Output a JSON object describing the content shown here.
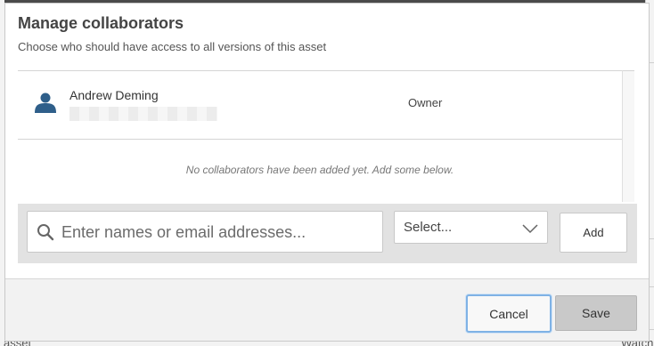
{
  "dialog": {
    "title": "Manage collaborators",
    "subtitle": "Choose who should have access to all versions of this asset"
  },
  "collaborators": [
    {
      "name": "Andrew Deming",
      "role": "Owner",
      "icon": "person-icon"
    }
  ],
  "empty_message": "No collaborators have been added yet. Add some below.",
  "add_bar": {
    "search_placeholder": "Enter names or email addresses...",
    "search_value": "",
    "role_select_value": "Select...",
    "add_label": "Add"
  },
  "footer": {
    "cancel_label": "Cancel",
    "save_label": "Save"
  },
  "background": {
    "fragment_bottom_left": "asset",
    "fragment_bottom_right": "Watch"
  },
  "colors": {
    "focus_ring": "#7fb2e5",
    "avatar": "#2f5f8a",
    "save_button_bg": "#c9c9c9"
  }
}
